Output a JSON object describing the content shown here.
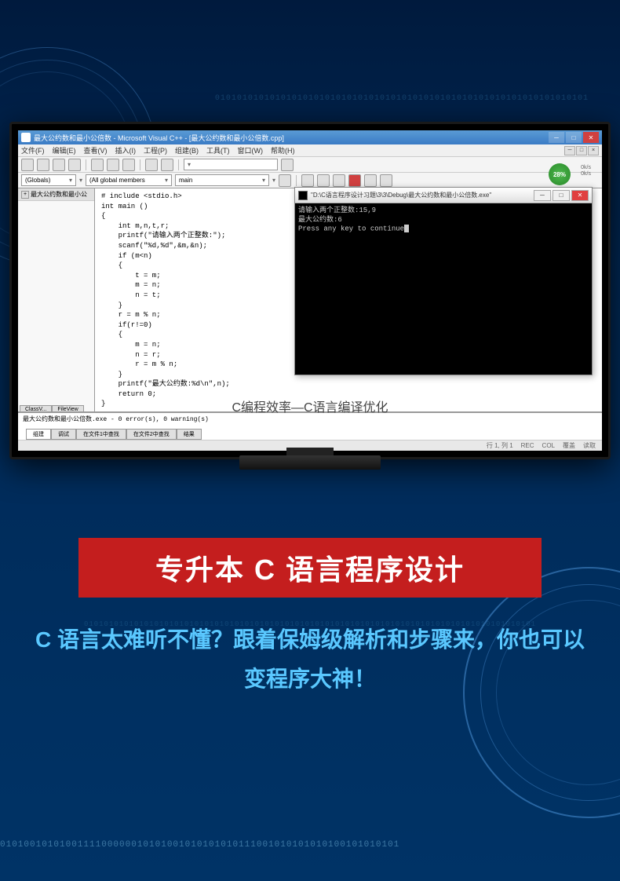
{
  "decorative": {
    "binary_top": "01010101010101010101010101010101010101010101010101010101010101010101",
    "binary_mid": "010101010101010101010101010101010101010101010101010101010101010101010101010101010101010101",
    "binary_bottom": "0101001010100111100000010101001010101010111001010101010100101010101"
  },
  "ide": {
    "title": "最大公约数和最小公倍数 - Microsoft Visual C++ - [最大公约数和最小公倍数.cpp]",
    "menu": {
      "file": "文件(F)",
      "edit": "编辑(E)",
      "view": "查看(V)",
      "insert": "插入(I)",
      "project": "工程(P)",
      "build": "组建(B)",
      "tools": "工具(T)",
      "window": "窗口(W)",
      "help": "帮助(H)"
    },
    "dropdowns": {
      "globals": "(Globals)",
      "members": "(All global members",
      "main": "main"
    },
    "badge": {
      "percent": "28%",
      "s1": "0k/s",
      "s2": "0k/s"
    },
    "sidebar": {
      "root": "最大公约数和最小公",
      "tab1": "ClassV...",
      "tab2": "FileView"
    },
    "code": {
      "l1": "# include <stdio.h>",
      "l2": "int main ()",
      "l3": "{",
      "l4": "    int m,n,t,r;",
      "l5": "    printf(\"请输入两个正整数:\");",
      "l6": "    scanf(\"%d,%d\",&m,&n);",
      "l7": "    if (m<n)",
      "l8": "    {",
      "l9": "        t = m;",
      "l10": "        m = n;",
      "l11": "        n = t;",
      "l12": "    }",
      "l13": "    r = m % n;",
      "l14": "    if(r!=0)",
      "l15": "    {",
      "l16": "        m = n;",
      "l17": "        n = r;",
      "l18": "        r = m % n;",
      "l19": "    }",
      "l20": "    printf(\"最大公约数:%d\\n\",n);",
      "l21": "",
      "l22": "",
      "l23": "    return 0;",
      "l24": "}"
    },
    "output": {
      "line": "最大公约数和最小公倍数.exe - 0 error(s), 0 warning(s)",
      "tab1": "组建",
      "tab2": "调试",
      "tab3": "在文件1中查找",
      "tab4": "在文件2中查找",
      "tab5": "结果"
    },
    "status": {
      "pos": "行 1, 列 1",
      "rec": "REC",
      "col": "COL",
      "over": "覆盖",
      "read": "读取"
    }
  },
  "console": {
    "title": "\"D:\\C语言程序设计习题\\3\\3\\Debug\\最大公约数和最小公倍数.exe\"",
    "line1": "请输入两个正整数:15,9",
    "line2": "最大公约数:6",
    "line3": "Press any key to continue"
  },
  "overlay": "C编程效率—C语言编译优化",
  "banner": {
    "title": "专升本 C 语言程序设计",
    "subtitle": "C 语言太难听不懂？跟着保姆级解析和步骤来，你也可以变程序大神！"
  }
}
